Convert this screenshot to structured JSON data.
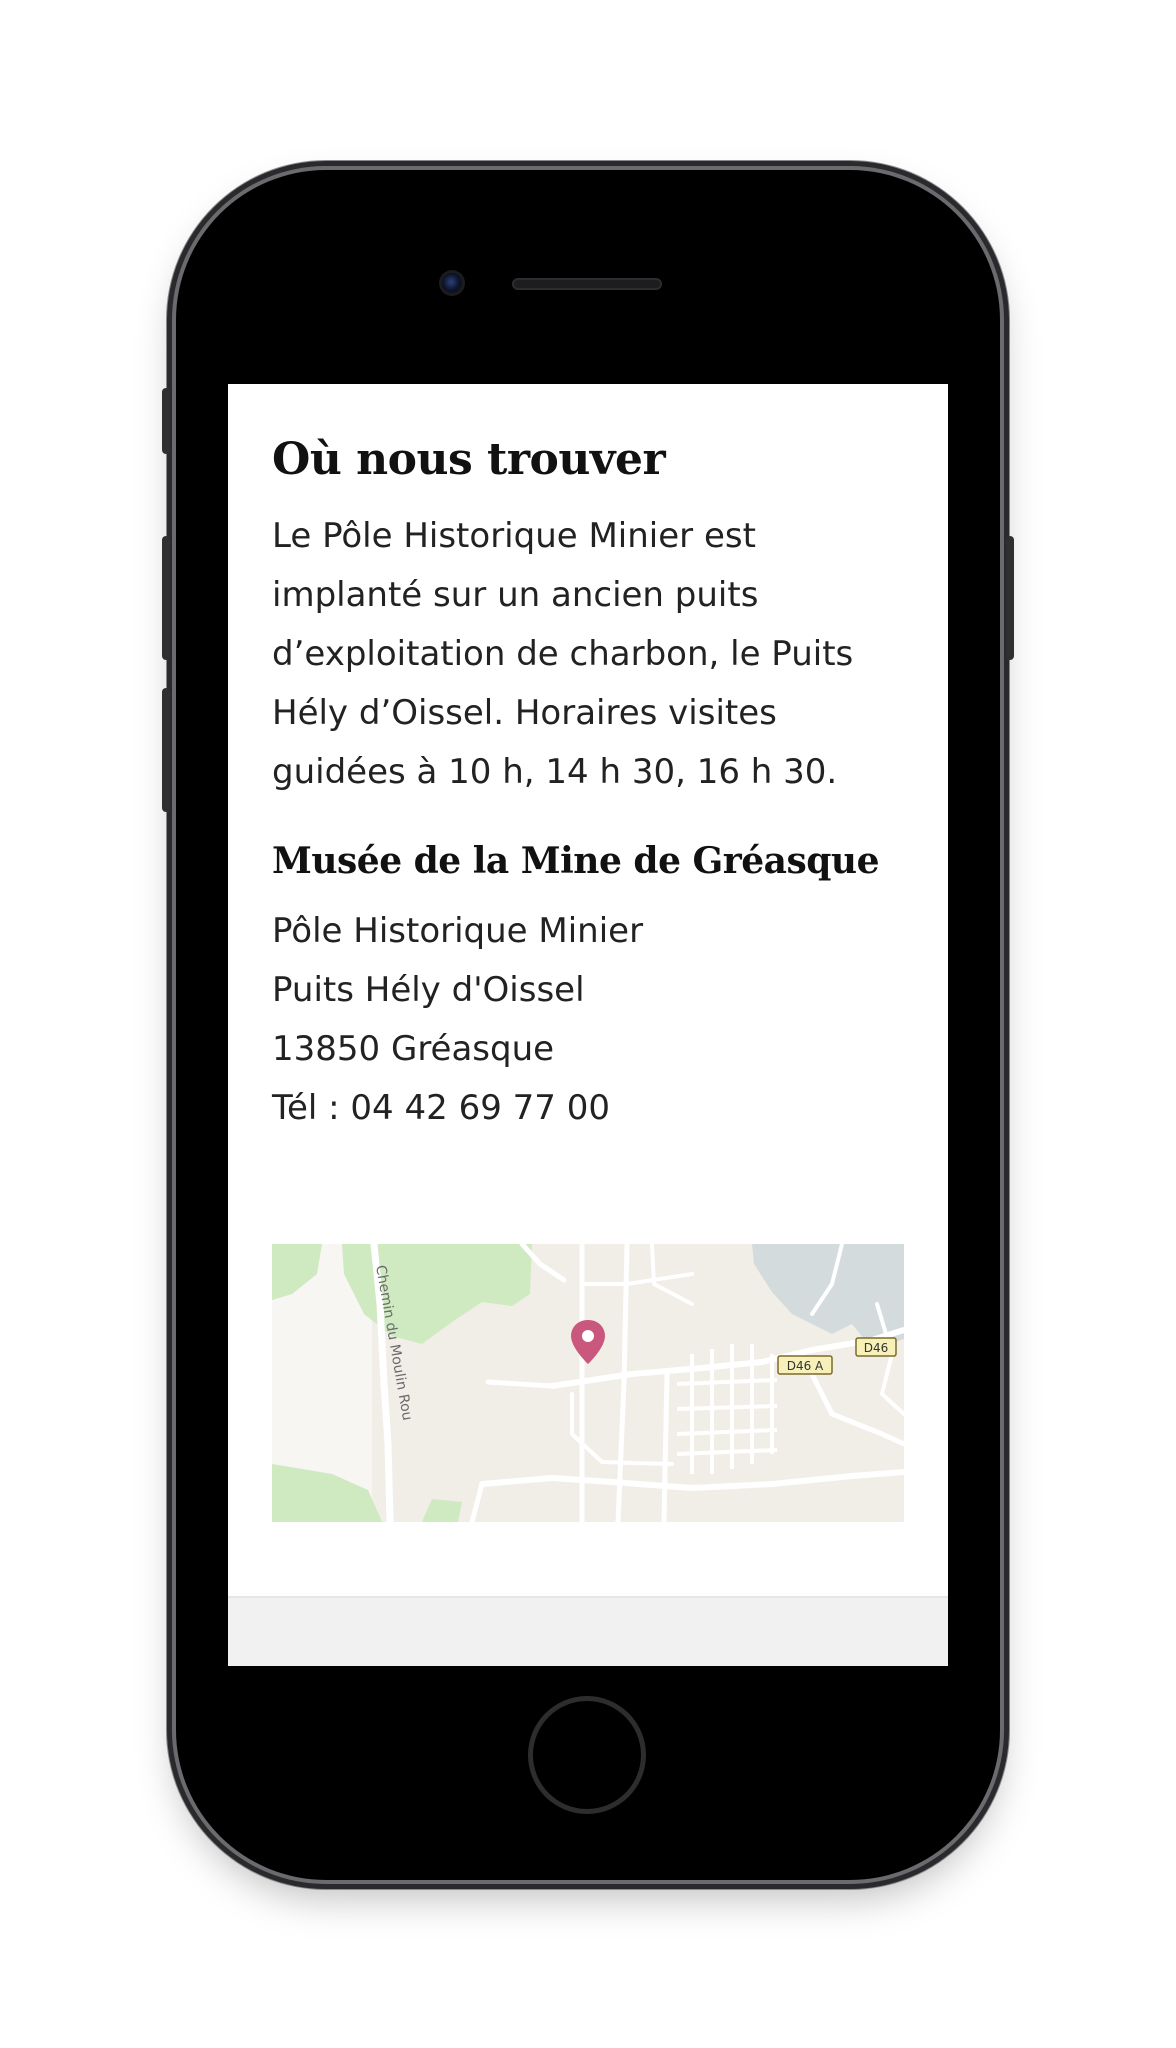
{
  "section": {
    "title": "Où nous trouver",
    "description": "Le Pôle Historique Minier est implanté sur un ancien puits d’exploitation de charbon, le Puits Hély d’Oissel. Horaires visites guidées à 10 h, 14 h 30, 16 h 30."
  },
  "museum": {
    "name": "Musée de la Mine de Gréasque",
    "address_lines": [
      "Pôle Historique Minier",
      "Puits Hély d'Oissel",
      "13850 Gréasque",
      "Tél : 04 42 69 77 00"
    ]
  },
  "map": {
    "road_label": "Chemin du Moulin Rou",
    "shields": [
      "D46 A",
      "D46"
    ],
    "marker_icon": "location-pin-icon",
    "marker_color": "#c9577e"
  }
}
